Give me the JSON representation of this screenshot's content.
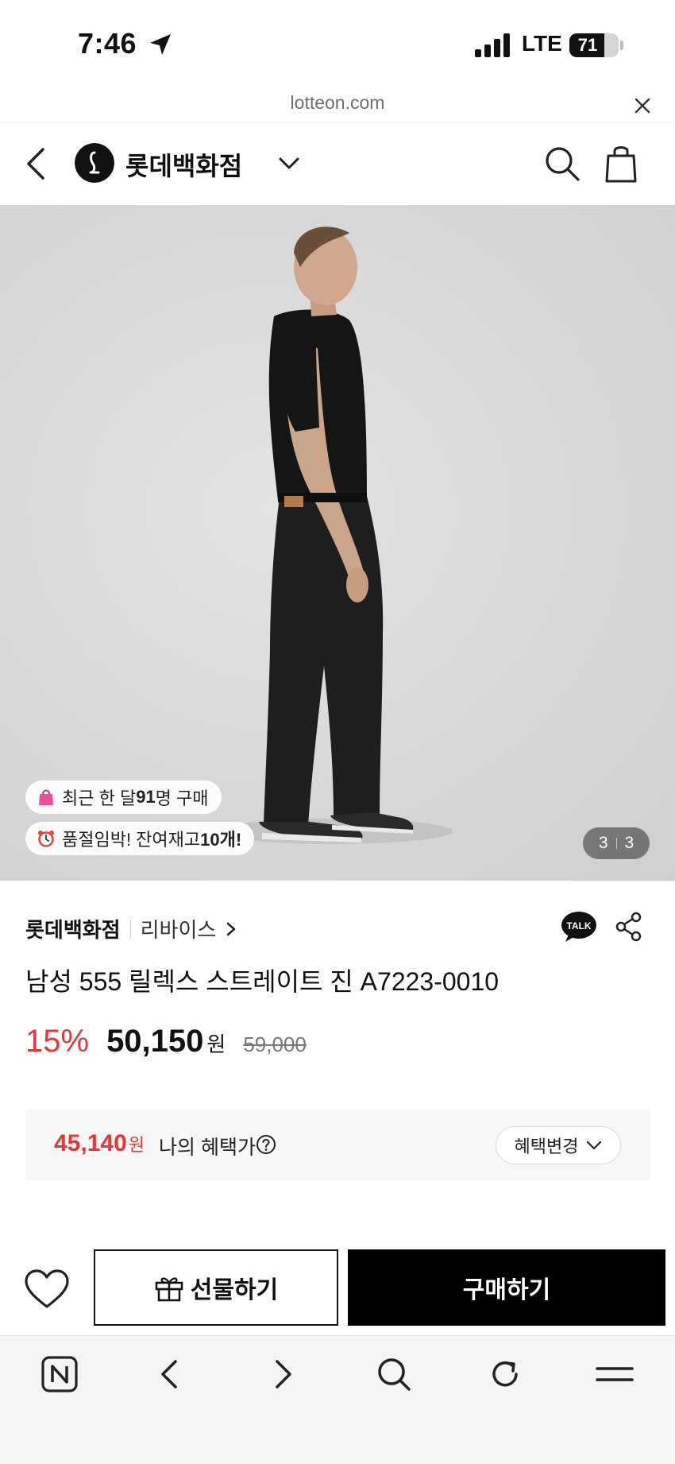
{
  "status_bar": {
    "time": "7:46",
    "network": "LTE",
    "battery_level": "71",
    "battery_fraction": 0.71
  },
  "browser": {
    "url": "lotteon.com"
  },
  "header": {
    "brand_name": "롯데백화점",
    "icons": [
      "back-chevron-icon",
      "lotte-logo-icon",
      "chevron-down-icon",
      "search-icon",
      "shopping-bag-icon"
    ]
  },
  "gallery": {
    "badge_buyers": {
      "prefix": "최근 한 달 ",
      "count": "91",
      "suffix": "명 구매",
      "icon": "shopping-bag-emoji-icon"
    },
    "badge_stock": {
      "prefix": "품절임박! 잔여재고 ",
      "count": "10개!",
      "icon": "alarm-clock-emoji-icon"
    },
    "current_image": "3",
    "total_images": "3"
  },
  "product": {
    "store": "롯데백화점",
    "brand": "리바이스",
    "title": "남성 555 릴렉스 스트레이트 진 A7223-0010",
    "discount": "15%",
    "sale_price": "50,150",
    "currency": "원",
    "original_price": "59,000"
  },
  "benefit": {
    "price": "45,140",
    "currency": "원",
    "label": "나의 혜택가",
    "change_label": "혜택변경"
  },
  "actions": {
    "gift_label": "선물하기",
    "buy_label": "구매하기"
  },
  "colors": {
    "accent_red": "#e6363a",
    "primary_black": "#000000",
    "hero_background": "#dcdcdc"
  },
  "toolbar_icons": [
    "naver-n-icon",
    "back-icon",
    "forward-icon",
    "search-icon",
    "refresh-icon",
    "menu-icon"
  ]
}
